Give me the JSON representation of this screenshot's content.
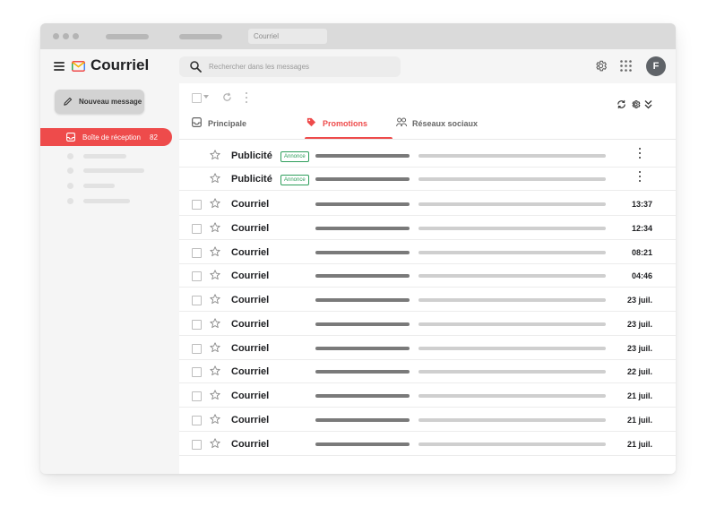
{
  "browser": {
    "tab_title": "Courriel"
  },
  "header": {
    "app_title": "Courriel",
    "search_placeholder": "Rechercher dans les messages",
    "avatar_letter": "F",
    "icons": [
      "menu-icon",
      "mail-logo-icon",
      "search-icon",
      "settings-icon",
      "apps-grid-icon"
    ]
  },
  "sidebar": {
    "compose_label": "Nouveau message",
    "inbox_label": "Boîte de réception",
    "inbox_count": "82"
  },
  "tabs": [
    {
      "label": "Principale",
      "icon": "inbox-icon",
      "active": false
    },
    {
      "label": "Promotions",
      "icon": "tag-icon",
      "active": true
    },
    {
      "label": "Réseaux sociaux",
      "icon": "people-icon",
      "active": false
    }
  ],
  "colors": {
    "accent": "#ee4b4b",
    "badge": "#2e9e5b"
  },
  "emails": [
    {
      "sender": "Publicité",
      "badge": "Annonce",
      "time": "",
      "ad": true
    },
    {
      "sender": "Publicité",
      "badge": "Annonce",
      "time": "",
      "ad": true
    },
    {
      "sender": "Courriel",
      "time": "13:37"
    },
    {
      "sender": "Courriel",
      "time": "12:34"
    },
    {
      "sender": "Courriel",
      "time": "08:21"
    },
    {
      "sender": "Courriel",
      "time": "04:46"
    },
    {
      "sender": "Courriel",
      "time": "23 juil."
    },
    {
      "sender": "Courriel",
      "time": "23 juil."
    },
    {
      "sender": "Courriel",
      "time": "23 juil."
    },
    {
      "sender": "Courriel",
      "time": "22 juil."
    },
    {
      "sender": "Courriel",
      "time": "21 juil."
    },
    {
      "sender": "Courriel",
      "time": "21 juil."
    },
    {
      "sender": "Courriel",
      "time": "21 juil."
    }
  ]
}
